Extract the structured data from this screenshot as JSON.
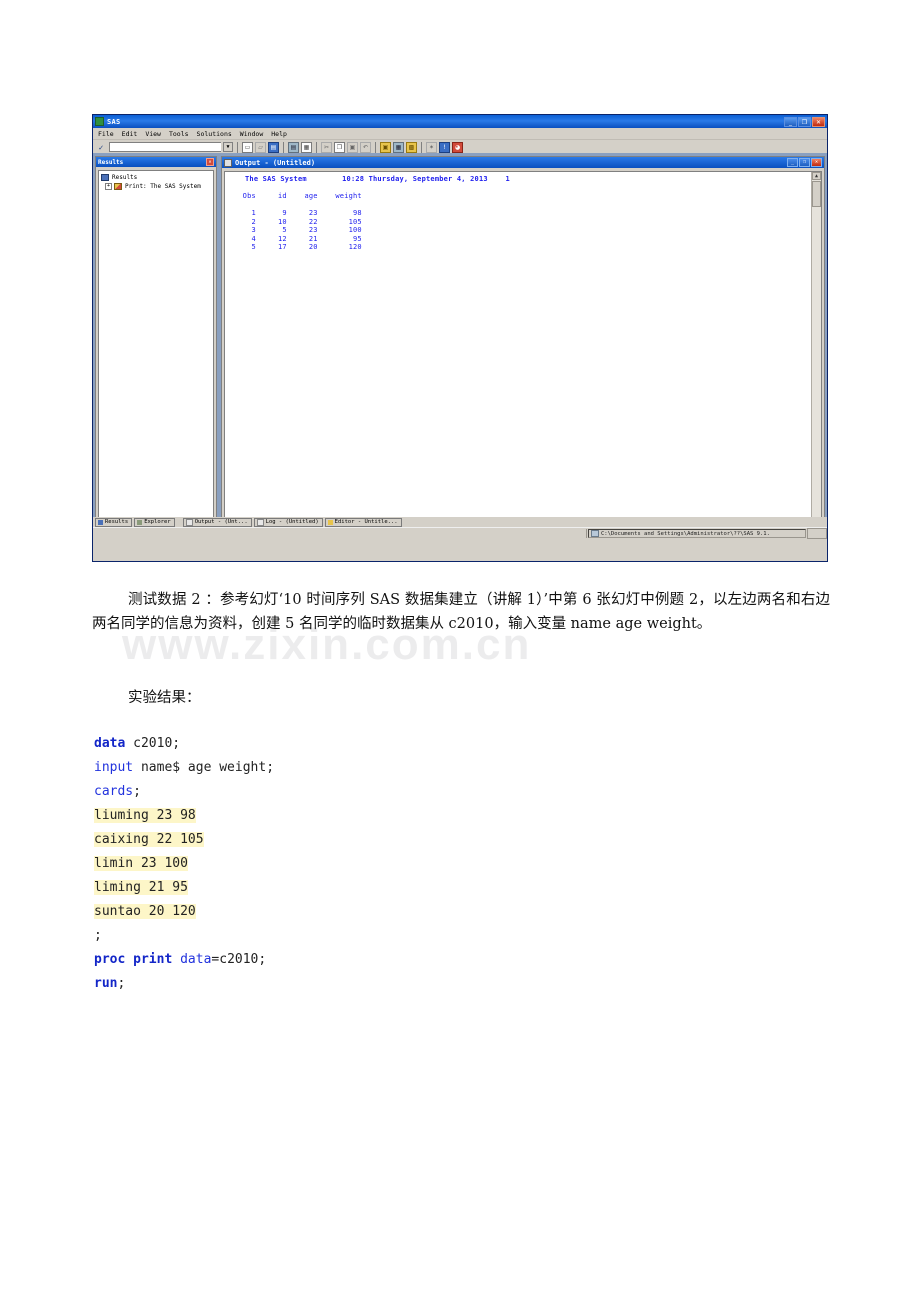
{
  "sas_window": {
    "title": "SAS",
    "title_icon": "sas-logo-icon",
    "window_controls": {
      "minimize": "_",
      "restore": "❐",
      "close": "✕"
    },
    "menu": [
      "File",
      "Edit",
      "View",
      "Tools",
      "Solutions",
      "Window",
      "Help"
    ],
    "command_bar": {
      "submit_glyph": "✓",
      "value": "",
      "placeholder": "",
      "dropdown_glyph": "▼"
    },
    "toolbar_icons": [
      "new-document-icon",
      "open-folder-icon",
      "save-disk-icon",
      "print-icon",
      "print-preview-icon",
      "cut-scissors-icon",
      "copy-icon",
      "paste-icon",
      "undo-icon",
      "new-library-icon",
      "explorer-icon",
      "new-program-icon",
      "run-icon",
      "help-icon",
      "clear-icon"
    ],
    "results_pane": {
      "title": "Results",
      "close_glyph": "✕",
      "tree": [
        {
          "label": "Results",
          "icon": "results-folder-icon",
          "expander": ""
        },
        {
          "label": "Print:  The SAS System",
          "icon": "print-output-icon",
          "expander": "+"
        }
      ]
    },
    "output_window": {
      "title": "Output - (Untitled)",
      "title_icon": "output-document-icon",
      "controls": {
        "minimize": "_",
        "maximize": "❐",
        "close": "✕"
      },
      "scrollbar": {
        "up_glyph": "▲",
        "down_glyph": "▼"
      },
      "header_line": "The SAS System        10:28 Thursday, September 4, 2013    1",
      "column_headers": [
        "Obs",
        "id",
        "age",
        "weight"
      ],
      "rows": [
        {
          "obs": "1",
          "id": "9",
          "age": "23",
          "weight": "98"
        },
        {
          "obs": "2",
          "id": "10",
          "age": "22",
          "weight": "105"
        },
        {
          "obs": "3",
          "id": "5",
          "age": "23",
          "weight": "100"
        },
        {
          "obs": "4",
          "id": "12",
          "age": "21",
          "weight": "95"
        },
        {
          "obs": "5",
          "id": "17",
          "age": "20",
          "weight": "120"
        }
      ]
    },
    "taskbar_tabs": [
      {
        "label": "Results",
        "icon": "results-icon"
      },
      {
        "label": "Explorer",
        "icon": "explorer-icon"
      }
    ],
    "window_tabs": [
      {
        "label": "Output - (Unt...",
        "icon": "output-icon",
        "active": true
      },
      {
        "label": "Log - (Untitled)",
        "icon": "log-icon",
        "active": false
      },
      {
        "label": "Editor - Untitle...",
        "icon": "editor-icon",
        "active": false
      }
    ],
    "status_bar": {
      "path_icon": "computer-icon",
      "path": "C:\\Documents and Settings\\Administrator\\??\\SAS 9.1."
    }
  },
  "document": {
    "paragraph_1": "测试数据 2 ：参考幻灯‘10 时间序列 SAS 数据集建立（讲解 1）’中第 6 张幻灯中例题 2，以左边两名和右边两名同学的信息为资料，创建 5 名同学的临时数据集从 c2010，输入变量 name age weight。",
    "paragraph_2": "实验结果：",
    "watermark": "www.zixin.com.cn"
  },
  "code": {
    "lines": [
      {
        "segments": [
          {
            "t": "data",
            "s": "kw"
          },
          {
            "t": " c2010;",
            "s": ""
          }
        ],
        "highlight": false
      },
      {
        "segments": [
          {
            "t": "input",
            "s": "kw2"
          },
          {
            "t": " name$ age weight;",
            "s": ""
          }
        ],
        "highlight": false
      },
      {
        "segments": [
          {
            "t": "cards",
            "s": "kw2"
          },
          {
            "t": ";",
            "s": ""
          }
        ],
        "highlight": false
      },
      {
        "segments": [
          {
            "t": "liuming 23 98",
            "s": ""
          }
        ],
        "highlight": true
      },
      {
        "segments": [
          {
            "t": "caixing 22 105",
            "s": ""
          }
        ],
        "highlight": true
      },
      {
        "segments": [
          {
            "t": "limin 23 100",
            "s": ""
          }
        ],
        "highlight": true
      },
      {
        "segments": [
          {
            "t": "liming 21 95",
            "s": ""
          }
        ],
        "highlight": true
      },
      {
        "segments": [
          {
            "t": "suntao 20 120",
            "s": ""
          }
        ],
        "highlight": true
      },
      {
        "segments": [
          {
            "t": ";",
            "s": ""
          }
        ],
        "highlight": false
      },
      {
        "segments": [
          {
            "t": "proc print",
            "s": "kw"
          },
          {
            "t": " ",
            "s": ""
          },
          {
            "t": "data",
            "s": "kw2"
          },
          {
            "t": "=c2010;",
            "s": ""
          }
        ],
        "highlight": false
      },
      {
        "segments": [
          {
            "t": "run",
            "s": "kw"
          },
          {
            "t": ";",
            "s": ""
          }
        ],
        "highlight": false
      }
    ]
  },
  "colors": {
    "titlebar_blue": "#0a4fbf",
    "sas_output_text": "#1f1fee",
    "code_keyword": "#1326c8",
    "highlight_yellow": "#fdf6c8",
    "window_face": "#d4d0c8"
  }
}
